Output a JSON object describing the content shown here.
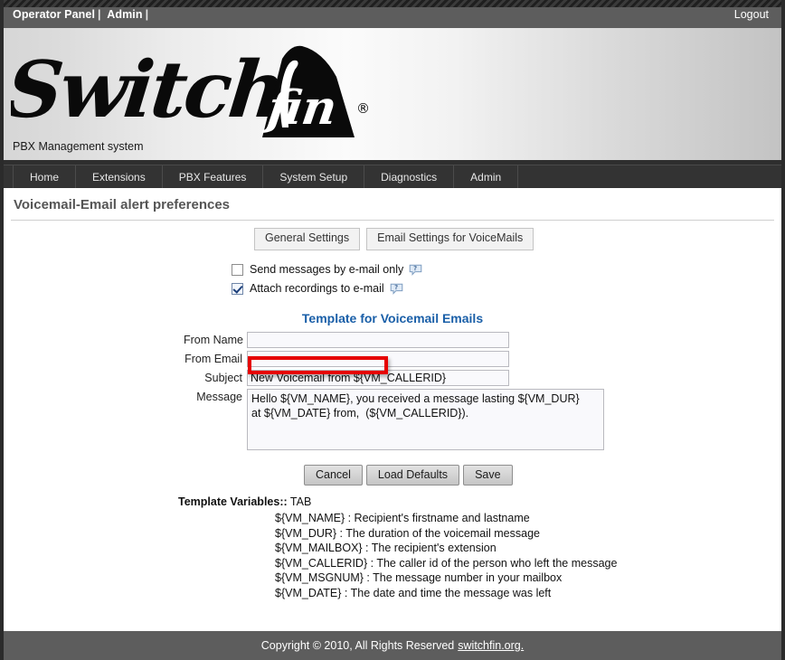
{
  "topbar": {
    "operator_panel": "Operator Panel",
    "admin": "Admin",
    "separator": "|",
    "logout": "Logout"
  },
  "banner": {
    "logo_text": "Switch fin",
    "registered_mark": "®",
    "tagline": "PBX Management system"
  },
  "nav": {
    "items": [
      {
        "label": "Home"
      },
      {
        "label": "Extensions"
      },
      {
        "label": "PBX Features"
      },
      {
        "label": "System Setup"
      },
      {
        "label": "Diagnostics"
      },
      {
        "label": "Admin"
      }
    ]
  },
  "page": {
    "title": "Voicemail-Email alert preferences"
  },
  "tabs": [
    {
      "label": "General Settings"
    },
    {
      "label": "Email Settings for VoiceMails"
    }
  ],
  "checkboxes": [
    {
      "label": "Send messages by e-mail only",
      "checked": false,
      "help_icon": "help-question-icon"
    },
    {
      "label": "Attach recordings to e-mail",
      "checked": true,
      "help_icon": "help-question-icon"
    }
  ],
  "template_section": {
    "heading": "Template for Voicemail Emails",
    "fields": {
      "from_name": {
        "label": "From Name",
        "value": "",
        "placeholder": ""
      },
      "from_email": {
        "label": "From Email",
        "value": "",
        "placeholder": ""
      },
      "subject": {
        "label": "Subject",
        "value": "New Voicemail from ${VM_CALLERID}",
        "placeholder": ""
      },
      "message": {
        "label": "Message",
        "value": "Hello ${VM_NAME}, you received a message lasting ${VM_DUR}\nat ${VM_DATE} from,  (${VM_CALLERID}).",
        "placeholder": ""
      }
    }
  },
  "buttons": [
    {
      "label": "Cancel"
    },
    {
      "label": "Load Defaults"
    },
    {
      "label": "Save"
    }
  ],
  "template_variables": {
    "heading": "Template Variables::",
    "heading_suffix": " TAB",
    "items": [
      "${VM_NAME} : Recipient's firstname and lastname",
      "${VM_DUR} : The duration of the voicemail message",
      "${VM_MAILBOX} : The recipient's extension",
      "${VM_CALLERID} : The caller id of the person who left the message",
      "${VM_MSGNUM} : The message number in your mailbox",
      "${VM_DATE} : The date and time the message was left"
    ]
  },
  "footer": {
    "text": "Copyright © 2010, All Rights Reserved",
    "link": "switchfin.org."
  },
  "annotation": {
    "highlight_color": "#e60000",
    "target": "from-email-field"
  }
}
